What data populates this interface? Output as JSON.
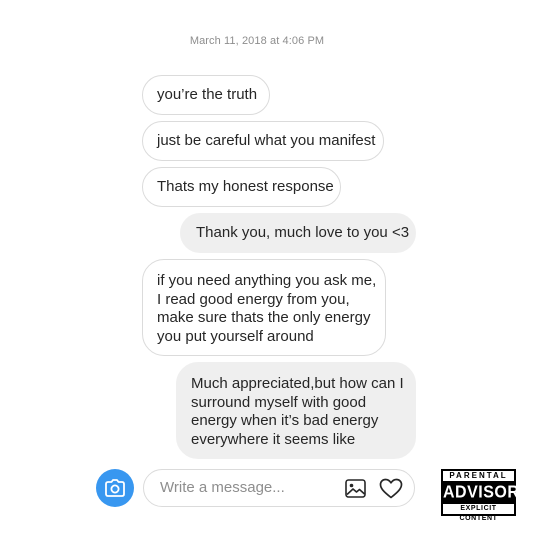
{
  "thread": {
    "timestamp": "March 11, 2018 at 4:06 PM",
    "messages": [
      {
        "direction": "incoming",
        "lines": [
          "you’re the truth"
        ]
      },
      {
        "direction": "incoming",
        "lines": [
          "just be careful what you manifest"
        ]
      },
      {
        "direction": "incoming",
        "lines": [
          "Thats my honest response"
        ]
      },
      {
        "direction": "outgoing",
        "lines": [
          "Thank you, much love to you <3"
        ]
      },
      {
        "direction": "incoming",
        "lines": [
          "if you need anything you ask me,",
          "I read good energy from you,",
          "make sure thats the only energy",
          "you put yourself around"
        ]
      },
      {
        "direction": "outgoing",
        "lines": [
          "Much appreciated,but how can I",
          "surround myself with good",
          "energy when it’s bad energy",
          "everywhere it seems like"
        ]
      }
    ]
  },
  "composer": {
    "placeholder": "Write a message...",
    "camera_icon": "camera-icon",
    "gallery_icon": "image-gallery-icon",
    "heart_icon": "heart-icon"
  },
  "advisory": {
    "top": "PARENTAL",
    "middle": "ADVISORY",
    "bottom": "EXPLICIT CONTENT"
  },
  "colors": {
    "accent": "#3897f0",
    "outgoing_bubble": "#efefef",
    "incoming_border": "#dbdbdb",
    "timestamp": "#8e8e8e"
  }
}
